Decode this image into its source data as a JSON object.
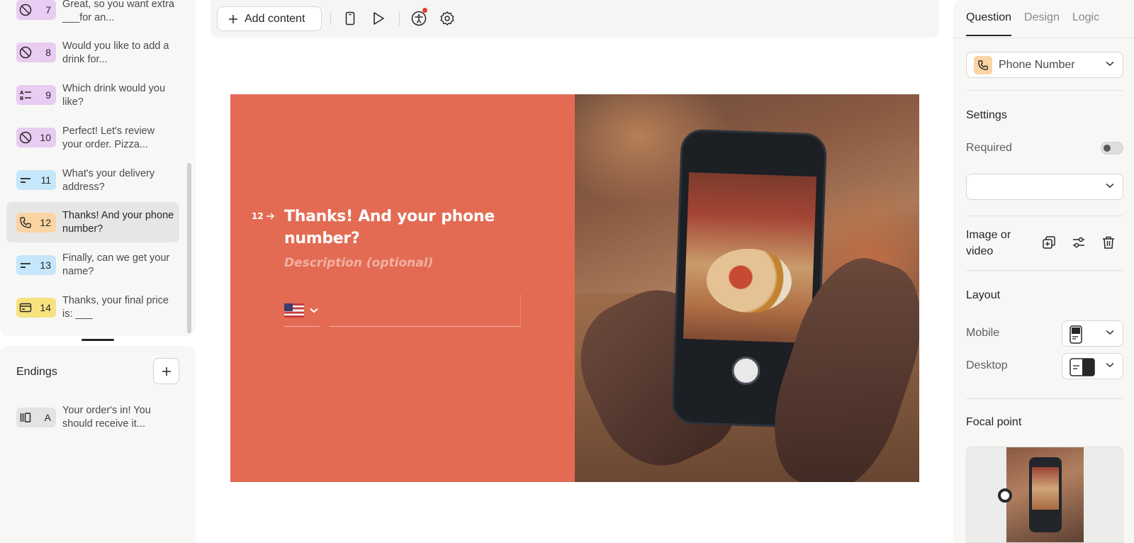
{
  "questions": [
    {
      "num": "7",
      "text": "Great, so you want extra ___for an...",
      "type": "statement",
      "color": "#e9ccf1"
    },
    {
      "num": "8",
      "text": "Would you like to add a drink for...",
      "type": "statement",
      "color": "#e9ccf1"
    },
    {
      "num": "9",
      "text": "Which drink would you like?",
      "type": "multiple-choice",
      "color": "#e9ccf1"
    },
    {
      "num": "10",
      "text": "Perfect! Let's review your order. Pizza...",
      "type": "statement",
      "color": "#e9ccf1"
    },
    {
      "num": "11",
      "text": "What's your delivery address?",
      "type": "short-text",
      "color": "#c5e6fb"
    },
    {
      "num": "12",
      "text": "Thanks! And your phone number?",
      "type": "phone",
      "color": "#fbd4a4"
    },
    {
      "num": "13",
      "text": "Finally, can we get your name?",
      "type": "short-text",
      "color": "#c5e6fb"
    },
    {
      "num": "14",
      "text": "Thanks, your final price is: ___",
      "type": "payment",
      "color": "#f6e27f"
    }
  ],
  "endings": {
    "title": "Endings",
    "items": [
      {
        "letter": "A",
        "text": "Your order's in! You should receive it..."
      }
    ]
  },
  "toolbar": {
    "add_content": "Add content"
  },
  "canvas": {
    "index": "12",
    "title": "Thanks! And your phone number?",
    "description": "Description (optional)",
    "background": "#e36b54"
  },
  "panel": {
    "tabs": [
      "Question",
      "Design",
      "Logic"
    ],
    "question_type": "Phone Number",
    "settings_title": "Settings",
    "required_label": "Required",
    "image_label": "Image or video",
    "layout_title": "Layout",
    "mobile_label": "Mobile",
    "desktop_label": "Desktop",
    "focal_title": "Focal point"
  }
}
